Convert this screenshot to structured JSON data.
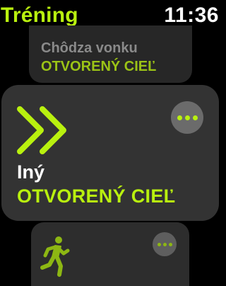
{
  "status_bar": {
    "app_title": "Tréning",
    "time": "11:36"
  },
  "workouts": [
    {
      "name": "Chôdza vonku",
      "goal": "OTVORENÝ CIEĽ",
      "icon": "walking-icon"
    },
    {
      "name": "Iný",
      "goal": "OTVORENÝ CIEĽ",
      "icon": "double-chevron-right-icon",
      "more_icon": "ellipsis-icon"
    },
    {
      "name": "",
      "goal": "",
      "icon": "running-icon",
      "more_icon": "ellipsis-icon"
    }
  ],
  "colors": {
    "accent": "#b9f10f",
    "background": "#000000",
    "card": "#333333",
    "more_button": "#6b6b6b"
  }
}
